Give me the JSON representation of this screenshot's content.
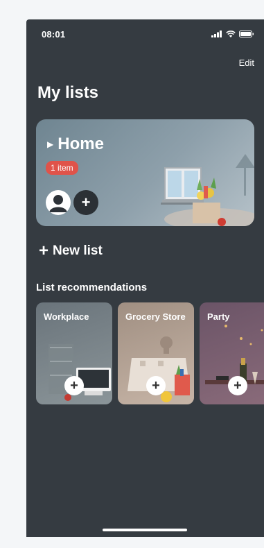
{
  "status_bar": {
    "time": "08:01"
  },
  "header": {
    "edit_label": "Edit",
    "title": "My lists"
  },
  "home_list": {
    "name": "Home",
    "item_count_badge": "1 item",
    "badge_color": "#e0534a"
  },
  "actions": {
    "new_list_label": "New list"
  },
  "recommendations": {
    "title": "List recommendations",
    "items": [
      {
        "label": "Workplace"
      },
      {
        "label": "Grocery Store"
      },
      {
        "label": "Party"
      }
    ]
  },
  "icons": [
    "signal-icon",
    "wifi-icon",
    "battery-icon",
    "caret-icon",
    "avatar-icon",
    "plus-icon"
  ]
}
